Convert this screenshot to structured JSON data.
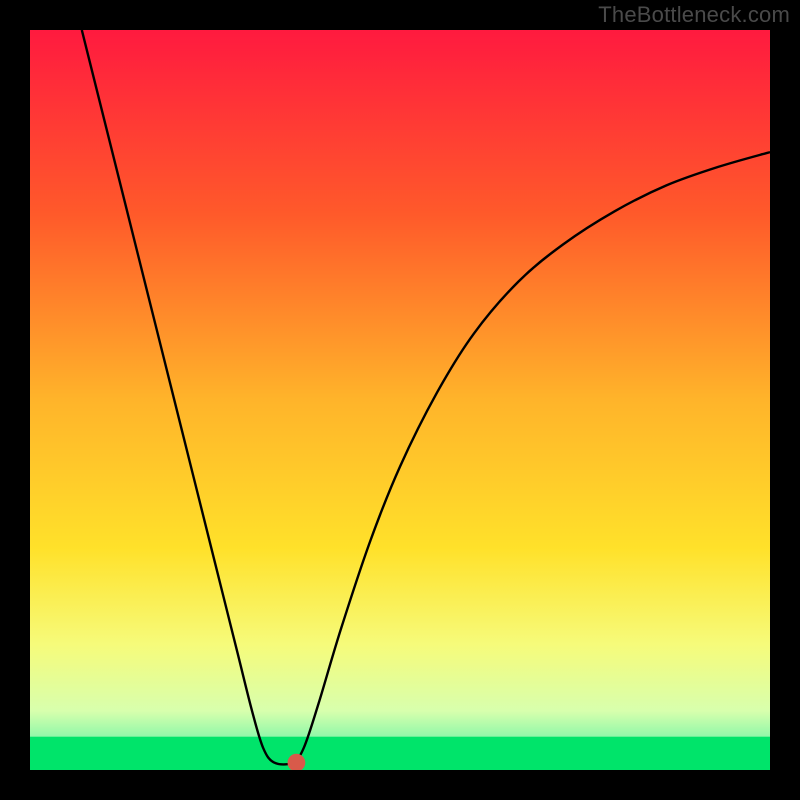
{
  "watermark": "TheBottleneck.com",
  "chart_data": {
    "type": "line",
    "title": "",
    "xlabel": "",
    "ylabel": "",
    "xlim": [
      0,
      100
    ],
    "ylim": [
      0,
      100
    ],
    "background_gradient": {
      "stops": [
        {
          "offset": 0.0,
          "color": "#ff1a3f"
        },
        {
          "offset": 0.25,
          "color": "#ff5a2a"
        },
        {
          "offset": 0.5,
          "color": "#ffb42a"
        },
        {
          "offset": 0.7,
          "color": "#ffe12a"
        },
        {
          "offset": 0.83,
          "color": "#f6fb7a"
        },
        {
          "offset": 0.92,
          "color": "#d8ffad"
        },
        {
          "offset": 0.965,
          "color": "#7cf6a8"
        },
        {
          "offset": 1.0,
          "color": "#00e46a"
        }
      ]
    },
    "green_band": {
      "y_top": 95.5,
      "y_bottom": 100
    },
    "series": [
      {
        "name": "curve",
        "color": "#000000",
        "stroke_width": 2.4,
        "points": [
          {
            "x": 7,
            "y": 100
          },
          {
            "x": 10,
            "y": 88
          },
          {
            "x": 13,
            "y": 76
          },
          {
            "x": 16,
            "y": 64
          },
          {
            "x": 19,
            "y": 52
          },
          {
            "x": 22,
            "y": 40
          },
          {
            "x": 25,
            "y": 28
          },
          {
            "x": 28,
            "y": 16
          },
          {
            "x": 30,
            "y": 8
          },
          {
            "x": 31.5,
            "y": 3
          },
          {
            "x": 33,
            "y": 1
          },
          {
            "x": 35.5,
            "y": 1
          },
          {
            "x": 37,
            "y": 3
          },
          {
            "x": 39,
            "y": 9
          },
          {
            "x": 42,
            "y": 19
          },
          {
            "x": 46,
            "y": 31
          },
          {
            "x": 50,
            "y": 41
          },
          {
            "x": 55,
            "y": 51
          },
          {
            "x": 60,
            "y": 59
          },
          {
            "x": 66,
            "y": 66
          },
          {
            "x": 72,
            "y": 71
          },
          {
            "x": 79,
            "y": 75.5
          },
          {
            "x": 86,
            "y": 79
          },
          {
            "x": 93,
            "y": 81.5
          },
          {
            "x": 100,
            "y": 83.5
          }
        ]
      }
    ],
    "marker": {
      "x": 36,
      "y": 1,
      "r": 1.2,
      "fill": "#d85a4a"
    }
  }
}
